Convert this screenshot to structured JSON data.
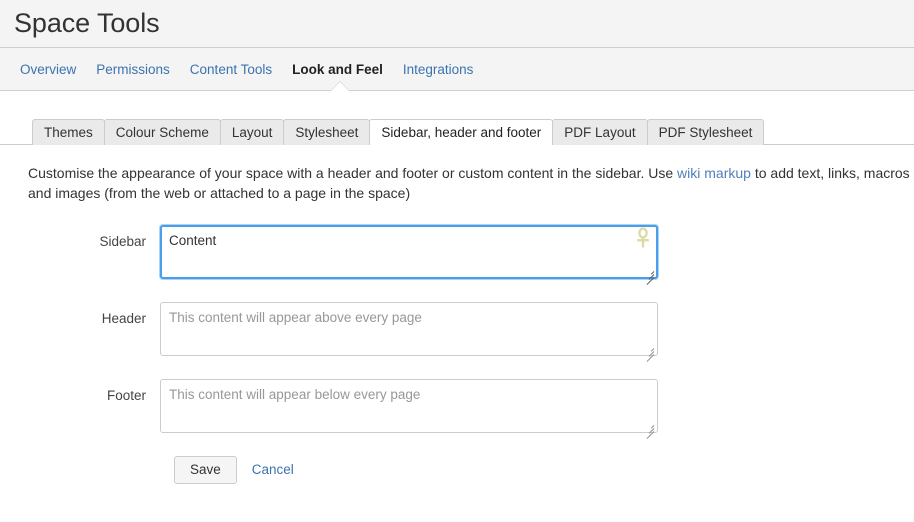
{
  "header": {
    "title": "Space Tools"
  },
  "primary_nav": {
    "items": [
      {
        "label": "Overview",
        "active": false
      },
      {
        "label": "Permissions",
        "active": false
      },
      {
        "label": "Content Tools",
        "active": false
      },
      {
        "label": "Look and Feel",
        "active": true
      },
      {
        "label": "Integrations",
        "active": false
      }
    ],
    "link_color": "#3b73af",
    "active_color": "#222222"
  },
  "sub_tabs": {
    "items": [
      {
        "label": "Themes",
        "active": false
      },
      {
        "label": "Colour Scheme",
        "active": false
      },
      {
        "label": "Layout",
        "active": false
      },
      {
        "label": "Stylesheet",
        "active": false
      },
      {
        "label": "Sidebar, header and footer",
        "active": true
      },
      {
        "label": "PDF Layout",
        "active": false
      },
      {
        "label": "PDF Stylesheet",
        "active": false
      }
    ]
  },
  "intro": {
    "part1": "Customise the appearance of your space with a header and footer or custom content in the sidebar. Use ",
    "link": "wiki markup",
    "part2": " to add text, links, macros and images (from the web or attached to a page in the space)"
  },
  "form": {
    "fields": [
      {
        "label": "Sidebar",
        "value": "Content",
        "placeholder": "",
        "focused": true,
        "icon": "ankh-macro-icon"
      },
      {
        "label": "Header",
        "value": "",
        "placeholder": "This content will appear above every page",
        "focused": false,
        "icon": ""
      },
      {
        "label": "Footer",
        "value": "",
        "placeholder": "This content will appear below every page",
        "focused": false,
        "icon": ""
      }
    ]
  },
  "actions": {
    "save_label": "Save",
    "cancel_label": "Cancel"
  },
  "colors": {
    "chrome_bg": "#f4f4f4",
    "border": "#cccccc",
    "link": "#3b73af",
    "focus_ring": "#4b9ee8",
    "placeholder": "#989898"
  }
}
